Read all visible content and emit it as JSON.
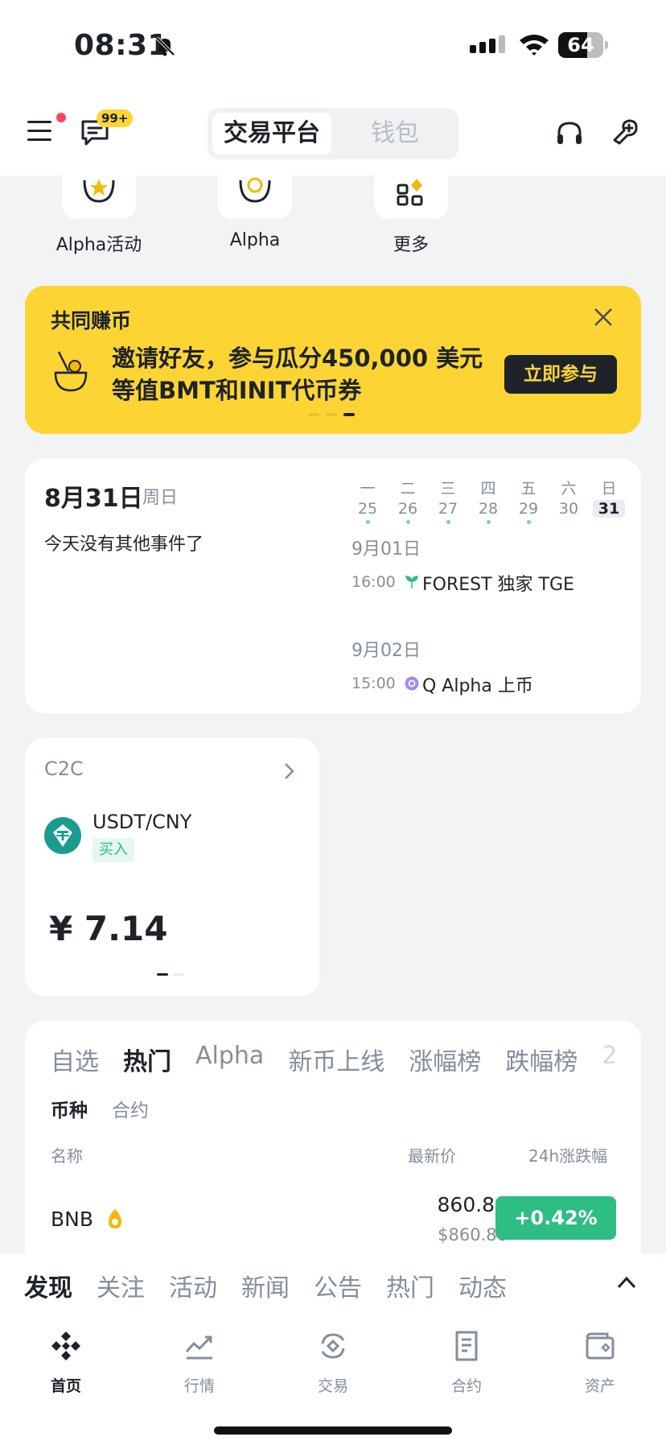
{
  "status_bar": {
    "time": "08:31",
    "battery": "64",
    "battery_level": 0.64
  },
  "top_nav": {
    "message_badge": "99+",
    "segments": [
      "交易平台",
      "钱包"
    ]
  },
  "quick_actions": [
    {
      "label": "Alpha活动",
      "icon": "star-coin-icon"
    },
    {
      "label": "Alpha",
      "icon": "alpha-icon"
    },
    {
      "label": "更多",
      "icon": "more-grid-icon"
    }
  ],
  "banner": {
    "title": "共同赚币",
    "text": "邀请好友，参与瓜分450,000 美元等值BMT和INIT代币券",
    "button": "立即参与",
    "background": "#FCD535"
  },
  "calendar": {
    "date": "8月31日",
    "weekday": "周日",
    "empty_text": "今天没有其他事件了",
    "week": [
      {
        "w": "一",
        "d": "25",
        "dot": true
      },
      {
        "w": "二",
        "d": "26",
        "dot": true
      },
      {
        "w": "三",
        "d": "27",
        "dot": true
      },
      {
        "w": "四",
        "d": "28",
        "dot": true
      },
      {
        "w": "五",
        "d": "29",
        "dot": true
      },
      {
        "w": "六",
        "d": "30",
        "dot": false
      },
      {
        "w": "日",
        "d": "31",
        "dot": false,
        "today": true
      }
    ],
    "events": [
      {
        "date": "9月01日",
        "time": "16:00",
        "name": "FOREST 独家 TGE",
        "icon": "sprout-icon"
      },
      {
        "date": "9月02日",
        "time": "15:00",
        "name": "Q Alpha 上币",
        "icon": "alpha-badge-icon"
      }
    ]
  },
  "c2c": {
    "title": "C2C",
    "pair": "USDT/CNY",
    "action": "买入",
    "price": "¥ 7.14"
  },
  "market": {
    "tabs": [
      "自选",
      "热门",
      "Alpha",
      "新币上线",
      "涨幅榜",
      "跌幅榜",
      "2"
    ],
    "active_tab": "热门",
    "subtabs": [
      "币种",
      "合约"
    ],
    "columns": {
      "name": "名称",
      "price": "最新价",
      "change": "24h涨跌幅"
    },
    "rows": [
      {
        "symbol": "BNB",
        "price": "860.86",
        "fiat": "$860.86",
        "change": "+0.42%",
        "change_color": "#2EBD85"
      }
    ]
  },
  "feed": {
    "tabs": [
      "发现",
      "关注",
      "活动",
      "新闻",
      "公告",
      "热门",
      "动态"
    ],
    "active": "发现"
  },
  "bottom_nav": [
    {
      "label": "首页",
      "icon": "binance-home-icon",
      "active": true
    },
    {
      "label": "行情",
      "icon": "chart-icon"
    },
    {
      "label": "交易",
      "icon": "trade-icon"
    },
    {
      "label": "合约",
      "icon": "contract-icon"
    },
    {
      "label": "资产",
      "icon": "wallet-icon"
    }
  ]
}
